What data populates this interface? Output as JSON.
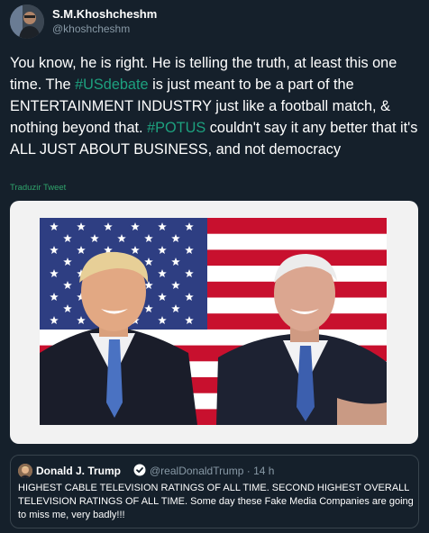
{
  "author": {
    "name": "S.M.Khoshcheshm",
    "handle": "@khoshcheshm"
  },
  "tweet": {
    "seg1": "You know, he is right. He is telling the truth, at least this one time. The ",
    "hashtag1": "#USdebate",
    "seg2": " is just meant to be a part of the ENTERTAINMENT INDUSTRY just like a football match, & nothing beyond that. ",
    "hashtag2": "#POTUS",
    "seg3": " couldn't say it any better that it's ALL JUST ABOUT BUSINESS, and not democracy",
    "translate_label": "Traduzir Tweet"
  },
  "quoted": {
    "name": "Donald J. Trump",
    "handle_time": "@realDonaldTrump · 14 h",
    "text": "HIGHEST CABLE TELEVISION RATINGS OF ALL TIME. SECOND HIGHEST OVERALL TELEVISION RATINGS OF ALL TIME. Some day these Fake Media Companies are going to miss me, very badly!!!"
  },
  "colors": {
    "background": "#15202b",
    "hashtag": "#1da17f",
    "translate": "#2fa36b",
    "muted": "#8899a6",
    "verified": "#1da1f2"
  },
  "icons": [
    "verified-badge-icon"
  ]
}
